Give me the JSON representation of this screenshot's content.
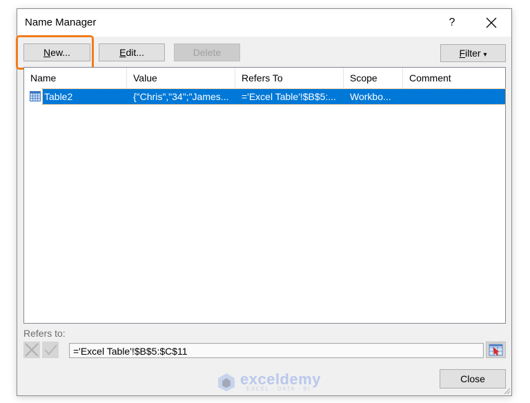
{
  "dialog": {
    "title": "Name Manager",
    "help_label": "?",
    "close_icon": "close-icon"
  },
  "toolbar": {
    "new_label_u": "N",
    "new_label_rest": "ew...",
    "edit_label_u": "E",
    "edit_label_rest": "dit...",
    "delete_label": "Delete",
    "filter_label_u": "F",
    "filter_label_rest": "ilter",
    "filter_arrow": "▾"
  },
  "table": {
    "columns": [
      "Name",
      "Value",
      "Refers To",
      "Scope",
      "Comment"
    ],
    "rows": [
      {
        "icon": "table-icon",
        "name": "Table2",
        "value": "{\"Chris\",\"34\";\"James...",
        "refers_to": "='Excel Table'!$B$5:...",
        "scope": "Workbo...",
        "comment": "",
        "selected": true
      }
    ]
  },
  "refers_to": {
    "label": "Refers to:",
    "value": "='Excel Table'!$B$5:$C$11",
    "cancel_icon": "cancel-x-icon",
    "confirm_icon": "checkmark-icon",
    "collapse_icon": "collapse-dialog-icon"
  },
  "footer": {
    "close_label": "Close"
  },
  "watermark": {
    "brand": "exceldemy",
    "tagline": "EXCEL · DATA · BI"
  },
  "colors": {
    "selection": "#0078d7",
    "highlight": "#f07c1c"
  }
}
